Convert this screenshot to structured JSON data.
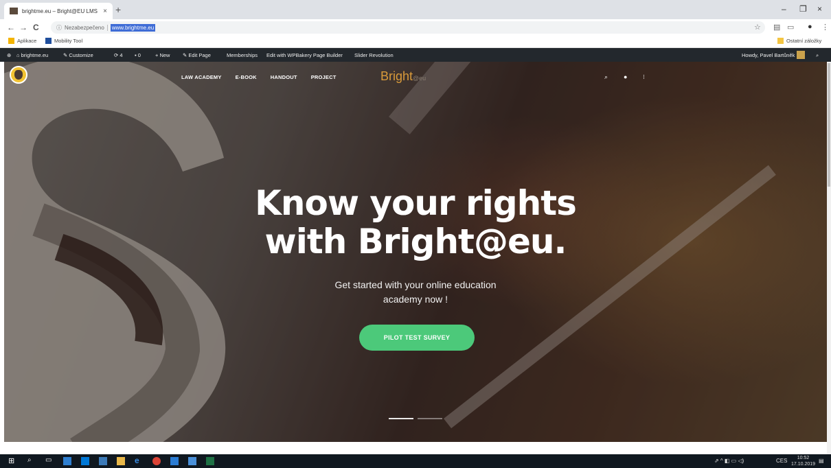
{
  "browser": {
    "tab_title": "brightme.eu – Bright@EU LMS",
    "tab_close": "×",
    "new_tab": "+",
    "window_controls": [
      "–",
      "❐",
      "×"
    ],
    "nav": {
      "back": "←",
      "forward": "→",
      "reload": "C"
    },
    "omnibox": {
      "security_label": "Nezabezpečeno",
      "url": "www.brightme.eu"
    },
    "bookmarks": [
      {
        "label": "Aplikace",
        "color": "#f4b400"
      },
      {
        "label": "Mobility Tool",
        "color": "#1f4e9c"
      }
    ],
    "other_bookmarks": "Ostatní záložky"
  },
  "wp_admin_bar": {
    "items": [
      "brightme.eu",
      "Customize",
      "4",
      "0",
      "New",
      "Edit Page",
      "Memberships",
      "Edit with WPBakery Page Builder",
      "Slider Revolution"
    ],
    "greeting": "Howdy, Pavel Bartůněk"
  },
  "site": {
    "nav_items": [
      "LAW ACADEMY",
      "E-BOOK",
      "HANDOUT",
      "PROJECT"
    ],
    "brand": {
      "main": "Bright",
      "suffix": "@eu"
    },
    "header_icons": [
      "search-icon",
      "cart-icon",
      "menu-icon"
    ]
  },
  "hero": {
    "headline_line1": "Know your rights",
    "headline_line2": "with Bright@eu.",
    "sub_line1": "Get started with your online education",
    "sub_line2": "academy now !",
    "cta_label": "PILOT TEST SURVEY",
    "cta_color": "#4cc97a",
    "slides_total": 2,
    "slide_active": 1
  },
  "taskbar": {
    "clock_time": "10:52",
    "clock_date": "17.10.2019",
    "lang": "CES"
  }
}
